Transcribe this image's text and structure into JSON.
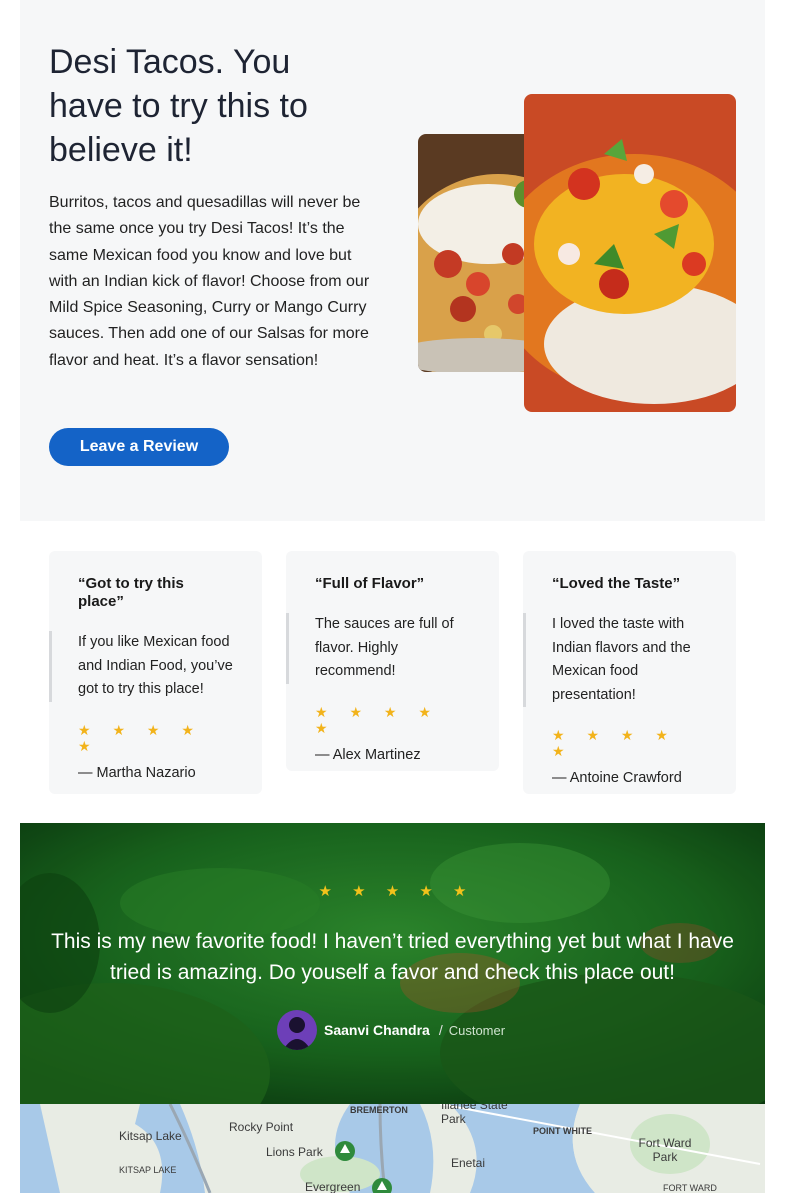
{
  "hero": {
    "title": "Desi Tacos. You have to try this to believe it!",
    "description": "Burritos, tacos and quesadillas will never be the same once you try Desi Tacos! It’s the same Mexican food you know and love but with an Indian kick of flavor! Choose from our Mild Spice Seasoning, Curry or Mango Curry sauces. Then add one of our Salsas for more flavor and heat. It’s a flavor sensation!",
    "button_label": "Leave a Review"
  },
  "reviews": [
    {
      "title": "“Got to try this place”",
      "quote": "If you like Mexican food and Indian Food, you’ve got to try this place!",
      "stars": "★ ★ ★ ★ ★",
      "rating": 5,
      "author": "— Martha Nazario"
    },
    {
      "title": "“Full of Flavor”",
      "quote": "The sauces are full of flavor. Highly recommend!",
      "stars": "★ ★ ★ ★ ★",
      "rating": 5,
      "author": "— Alex Martinez"
    },
    {
      "title": "“Loved the Taste”",
      "quote": "I loved the taste with Indian flavors and the Mexican food presentation!",
      "stars": "★ ★ ★ ★ ★",
      "rating": 5,
      "author": "— Antoine Crawford"
    }
  ],
  "featured": {
    "stars": "★ ★ ★ ★ ★",
    "rating": 5,
    "quote": "This is my new favorite food! I haven’t tried everything yet but what I have tried is amazing. Do youself a favor and check this place out!",
    "name": "Saanvi Chandra",
    "separator": "/",
    "role": "Customer"
  },
  "map": {
    "labels": [
      "BREMERTON",
      "Illahee State Park",
      "Kitsap Lake",
      "Rocky Point",
      "POINT WHITE",
      "Fort Ward Park",
      "Lions Park",
      "Enetai",
      "KITSAP LAKE",
      "Evergreen",
      "FORT WARD"
    ]
  },
  "colors": {
    "accent": "#1463c7",
    "star": "#f2b31b",
    "card_bg": "#f6f7f8"
  }
}
